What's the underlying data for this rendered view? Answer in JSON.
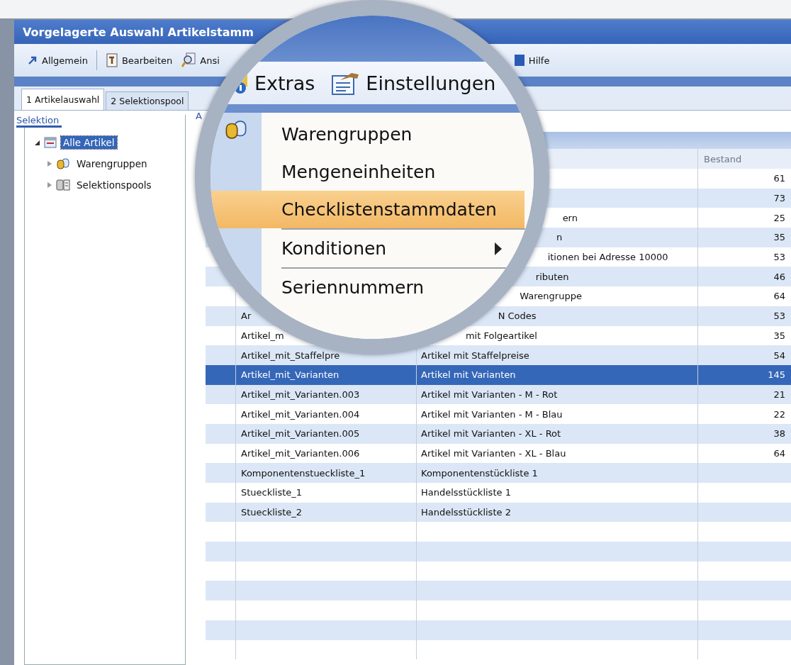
{
  "window": {
    "title": "Vorgelagerte Auswahl Artikelstamm"
  },
  "toolbar": {
    "items": [
      {
        "label": "Allgemein"
      },
      {
        "label": "Bearbeiten"
      },
      {
        "label": "Ansi"
      },
      {
        "label": "Hilfe"
      }
    ]
  },
  "tabs": [
    {
      "label": "1 Artikelauswahl",
      "selected": true
    },
    {
      "label": "2 Selektionspool",
      "selected": false
    }
  ],
  "selection_panel": {
    "title": "Selektion",
    "tree": [
      {
        "label": "Alle Artikel",
        "selected": true,
        "expanded": true,
        "children": [
          {
            "label": "Warengruppen",
            "selected": false,
            "expanded": false
          },
          {
            "label": "Selektionspools",
            "selected": false,
            "expanded": false
          }
        ]
      }
    ]
  },
  "article_panel": {
    "title": "A",
    "table": {
      "header": "Bestand",
      "rows": [
        {
          "column_1": "",
          "column_2": "",
          "bestand": "61",
          "selected": false
        },
        {
          "column_1": "",
          "column_2": "",
          "bestand": "73",
          "selected": false
        },
        {
          "column_1": "",
          "column_2": "ern",
          "bestand": "25",
          "selected": false
        },
        {
          "column_1": "",
          "column_2": "n",
          "bestand": "35",
          "selected": false
        },
        {
          "column_1": "",
          "column_2": "itionen bei Adresse 10000",
          "bestand": "53",
          "selected": false
        },
        {
          "column_1": "",
          "column_2": "ributen",
          "bestand": "46",
          "selected": false
        },
        {
          "column_1": "",
          "column_2": "Warengruppe",
          "bestand": "64",
          "selected": false
        },
        {
          "column_1": "Ar",
          "column_2": "N Codes",
          "bestand": "53",
          "selected": false
        },
        {
          "column_1": "Artikel_m",
          "column_2": "mit Folgeartikel",
          "bestand": "35",
          "selected": false
        },
        {
          "column_1": "Artikel_mit_Staffelpre",
          "column_2": "Artikel mit Staffelpreise",
          "bestand": "54",
          "selected": false
        },
        {
          "column_1": "Artikel_mit_Varianten",
          "column_2": "Artikel mit Varianten",
          "bestand": "145",
          "selected": true
        },
        {
          "column_1": "Artikel_mit_Varianten.003",
          "column_2": "Artikel mit Varianten - M - Rot",
          "bestand": "21",
          "selected": false
        },
        {
          "column_1": "Artikel_mit_Varianten.004",
          "column_2": "Artikel mit Varianten - M - Blau",
          "bestand": "22",
          "selected": false
        },
        {
          "column_1": "Artikel_mit_Varianten.005",
          "column_2": "Artikel mit Varianten - XL - Rot",
          "bestand": "38",
          "selected": false
        },
        {
          "column_1": "Artikel_mit_Varianten.006",
          "column_2": "Artikel mit Varianten - XL - Blau",
          "bestand": "64",
          "selected": false
        },
        {
          "column_1": "Komponentenstueckliste_1",
          "column_2": "Komponentenstückliste 1",
          "bestand": "",
          "selected": false
        },
        {
          "column_1": "Stueckliste_1",
          "column_2": "Handelsstückliste 1",
          "bestand": "",
          "selected": false
        },
        {
          "column_1": "Stueckliste_2",
          "column_2": "Handelsstückliste 2",
          "bestand": "",
          "selected": false
        }
      ]
    }
  },
  "magnifier": {
    "menubar": [
      {
        "label": "Extras"
      },
      {
        "label": "Einstellungen"
      }
    ],
    "menu": [
      {
        "label": "Warengruppen",
        "selected": false,
        "separator_before": false,
        "submenu": false
      },
      {
        "label": "Mengeneinheiten",
        "selected": false,
        "separator_before": false,
        "submenu": false
      },
      {
        "label": "Checklistenstammdaten",
        "selected": true,
        "separator_before": false,
        "submenu": false
      },
      {
        "label": "Konditionen",
        "selected": false,
        "separator_before": true,
        "submenu": true
      },
      {
        "label": "Seriennummern",
        "selected": false,
        "separator_before": true,
        "submenu": false
      }
    ]
  }
}
